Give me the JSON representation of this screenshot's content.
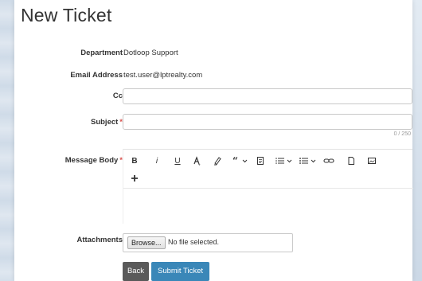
{
  "page": {
    "title": "New Ticket"
  },
  "form": {
    "department": {
      "label": "Department",
      "value": "Dotloop Support"
    },
    "email": {
      "label": "Email Address",
      "value": "test.user@lptrealty.com"
    },
    "cc": {
      "label": "Cc",
      "value": ""
    },
    "subject": {
      "label": "Subject",
      "required_mark": "*",
      "value": "",
      "counter": "0 / 250"
    },
    "message_body": {
      "label": "Message Body",
      "required_mark": "*"
    },
    "attachments": {
      "label": "Attachments",
      "browse_label": "Browse...",
      "no_file_text": "No file selected."
    }
  },
  "toolbar": {
    "bold": "B",
    "italic": "i",
    "underline": "U",
    "icons": [
      "bold-icon",
      "italic-icon",
      "underline-icon",
      "font-color-icon",
      "highlight-icon",
      "quote-icon",
      "document-icon",
      "ordered-list-icon",
      "unordered-list-icon",
      "link-icon",
      "file-icon",
      "image-icon",
      "add-icon"
    ]
  },
  "buttons": {
    "back": "Back",
    "submit": "Submit Ticket"
  },
  "colors": {
    "accent": "#3a87b8",
    "back": "#5a5a5a",
    "required": "#d9534f"
  }
}
